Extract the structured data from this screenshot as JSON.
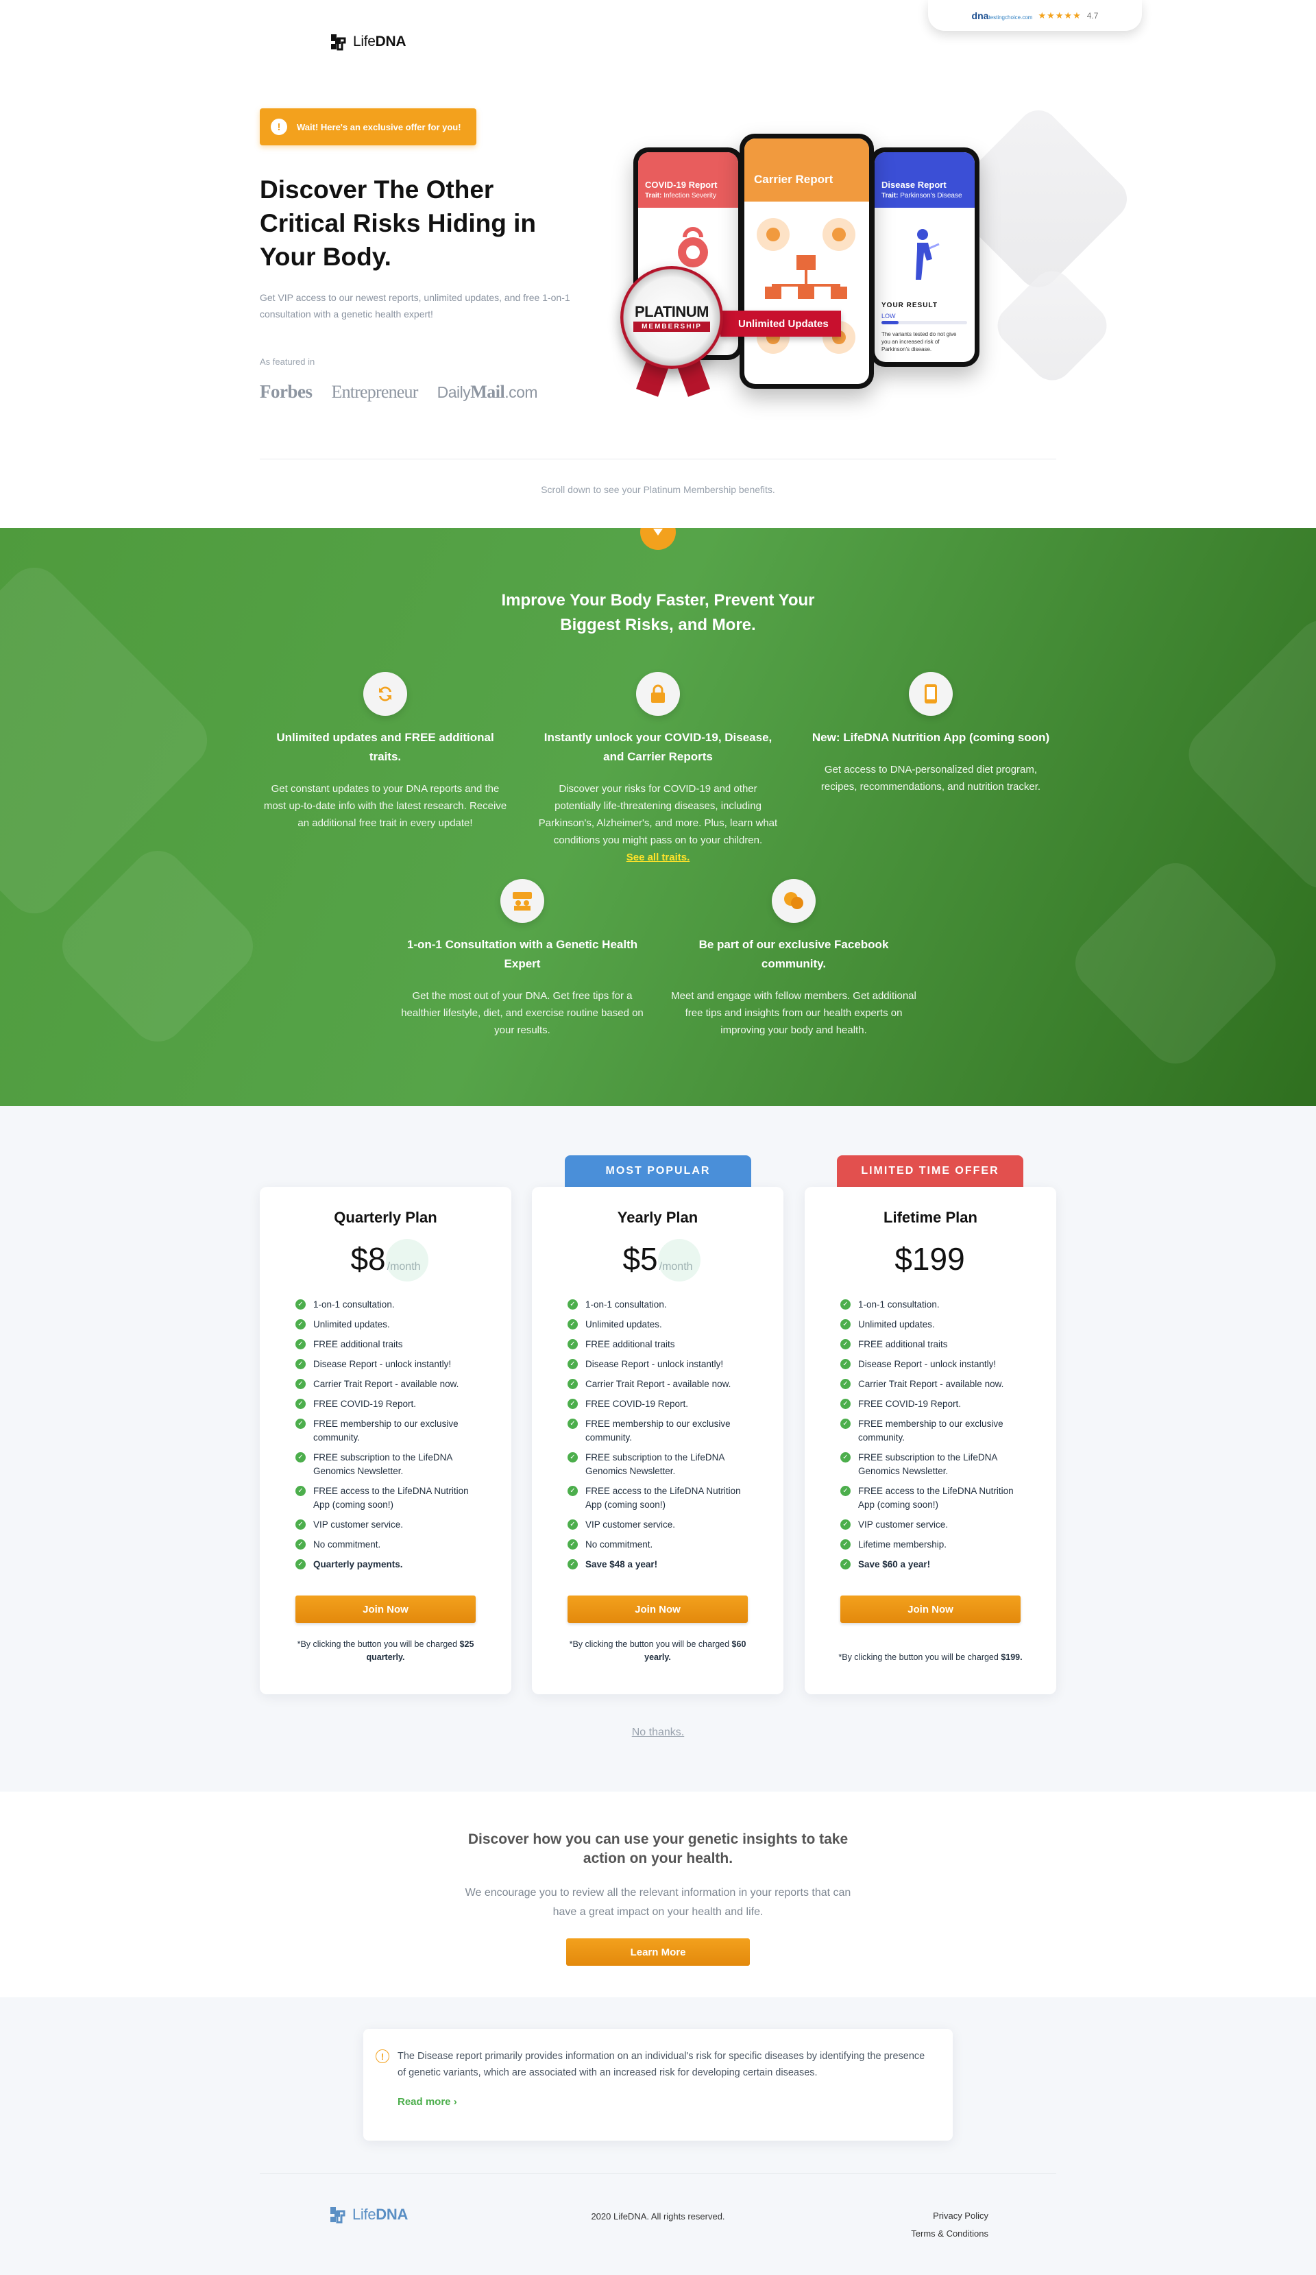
{
  "brand": {
    "name_light": "Life",
    "name_bold": "DNA"
  },
  "rating": {
    "brand": "dna",
    "brand_suffix": "testingchoice.com",
    "stars": "★★★★★",
    "score": "4.7"
  },
  "hero": {
    "offer": "Wait! Here's an exclusive offer for you!",
    "title": "Discover The Other Critical Risks Hiding in Your Body.",
    "subtitle": "Get VIP access to our newest reports, unlimited updates, and free 1-on-1 consultation with a genetic health expert!",
    "featured_label": "As featured in",
    "press": {
      "forbes": "Forbes",
      "entrepreneur": "Entrepreneur",
      "daily": "Daily",
      "mail": "Mail",
      "com": ".com"
    },
    "phones": {
      "left": {
        "title": "COVID-19 Report",
        "trait_label": "Trait:",
        "trait": "Infection Severity"
      },
      "center": {
        "title": "Carrier Report"
      },
      "right": {
        "title": "Disease Report",
        "trait_label": "Trait:",
        "trait": "Parkinson's Disease",
        "result_label": "YOUR RESULT",
        "result": "LOW",
        "result_text": "The variants tested do not give you an increased risk of Parkinson's disease."
      }
    },
    "badge": {
      "title": "PLATINUM",
      "sub": "MEMBERSHIP",
      "ribbon": "Unlimited Updates"
    }
  },
  "scroll_note": "Scroll down to see your Platinum Membership benefits.",
  "benefits": {
    "title": "Improve Your Body Faster, Prevent Your Biggest Risks, and More.",
    "items": [
      {
        "icon": "refresh-icon",
        "title": "Unlimited updates and FREE additional traits.",
        "text": "Get constant updates to your DNA reports and the most up-to-date info with the latest research. Receive an additional free trait in every update!"
      },
      {
        "icon": "lock-icon",
        "title": "Instantly unlock your COVID-19, Disease, and Carrier Reports",
        "text": "Discover your risks for COVID-19 and other potentially life-threatening diseases, including Parkinson's, Alzheimer's, and more. Plus, learn what conditions you might pass on to your children.",
        "link": "See all traits."
      },
      {
        "icon": "phone-icon",
        "title": "New: LifeDNA Nutrition App (coming soon)",
        "text": "Get access to DNA-personalized diet program, recipes, recommendations, and nutrition tracker."
      },
      {
        "icon": "consultation-icon",
        "title": "1-on-1 Consultation with a Genetic Health Expert",
        "text": "Get the most out of your DNA. Get free tips for a healthier lifestyle, diet, and exercise routine based on your results."
      },
      {
        "icon": "chat-icon",
        "title": "Be part of our exclusive Facebook community.",
        "text": "Meet and engage with fellow members. Get additional free tips and insights from our health experts on improving your body and health."
      }
    ]
  },
  "plans": [
    {
      "tag": "",
      "name": "Quarterly Plan",
      "price": "$8",
      "per": "/month",
      "features": [
        "1-on-1 consultation.",
        "Unlimited updates.",
        "FREE additional traits",
        "Disease Report - unlock instantly!",
        "Carrier Trait Report - available now.",
        "FREE COVID-19 Report.",
        "FREE membership to our exclusive community.",
        "FREE subscription to the LifeDNA Genomics Newsletter.",
        "FREE access to the LifeDNA Nutrition App (coming soon!)",
        "VIP customer service.",
        "No commitment."
      ],
      "last": "Quarterly payments.",
      "button": "Join Now",
      "note": "*By clicking the button you will be charged",
      "charge": "$25 quarterly."
    },
    {
      "tag": "MOST POPULAR",
      "name": "Yearly Plan",
      "price": "$5",
      "per": "/month",
      "features": [
        "1-on-1 consultation.",
        "Unlimited updates.",
        "FREE additional traits",
        "Disease Report - unlock instantly!",
        "Carrier Trait Report - available now.",
        "FREE COVID-19 Report.",
        "FREE membership to our exclusive community.",
        "FREE subscription to the LifeDNA Genomics Newsletter.",
        "FREE access to the LifeDNA Nutrition App (coming soon!)",
        "VIP customer service.",
        "No commitment."
      ],
      "last": "Save $48 a year!",
      "button": "Join Now",
      "note": "*By clicking the button you will be charged",
      "charge": "$60 yearly."
    },
    {
      "tag": "LIMITED TIME OFFER",
      "name": "Lifetime Plan",
      "price": "$199",
      "per": "",
      "features": [
        "1-on-1 consultation.",
        "Unlimited updates.",
        "FREE additional traits",
        "Disease Report - unlock instantly!",
        "Carrier Trait Report - available now.",
        "FREE COVID-19 Report.",
        "FREE membership to our exclusive community.",
        "FREE subscription to the LifeDNA Genomics Newsletter.",
        "FREE access to the LifeDNA Nutrition App (coming soon!)",
        "VIP customer service.",
        "Lifetime membership."
      ],
      "last": "Save $60 a year!",
      "button": "Join Now",
      "note": "*By clicking the button you will be charged",
      "charge": "$199."
    }
  ],
  "no_thanks": "No thanks.",
  "discover": {
    "title": "Discover how you can use your genetic insights to take action on your health.",
    "text": "We encourage you to review all the relevant information in your reports that can have a great impact on your health and life.",
    "button": "Learn More"
  },
  "notice": {
    "text": "The Disease report primarily provides information on an individual's risk for specific diseases by identifying the presence of genetic variants, which are associated with an increased risk for developing certain diseases.",
    "link": "Read more"
  },
  "footer": {
    "copyright": "2020 LifeDNA. All rights reserved.",
    "privacy": "Privacy Policy",
    "terms": "Terms & Conditions"
  },
  "colors": {
    "orange": "#f3a11d",
    "green": "#56a449",
    "blue_tag": "#4a8fd9",
    "red_tag": "#e2504e",
    "check": "#4cae4c"
  }
}
